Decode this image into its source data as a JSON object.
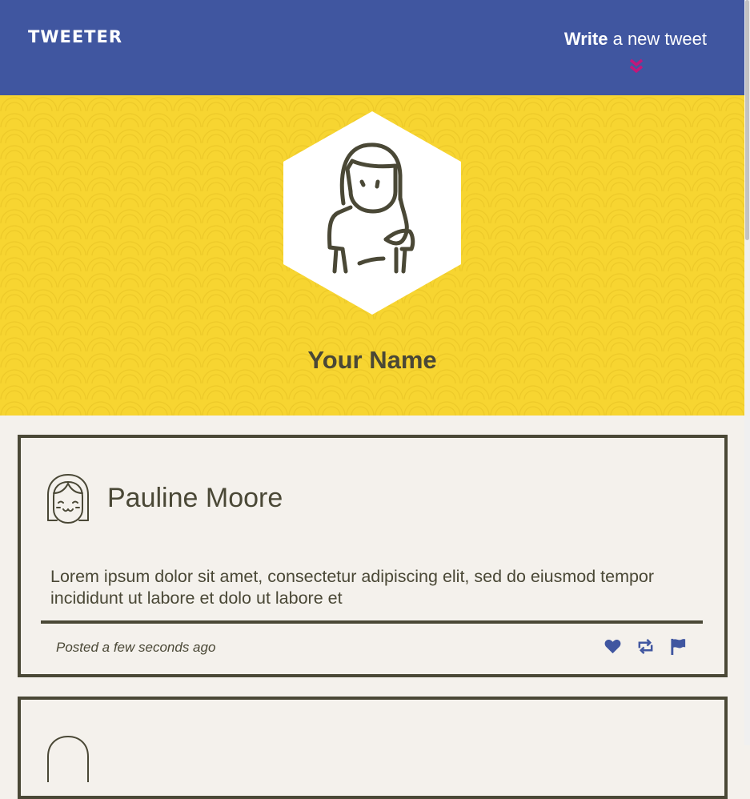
{
  "nav": {
    "brand": "TWEETER",
    "compose_bold": "Write",
    "compose_rest": " a new tweet",
    "compose_icon": "double-chevron-down-icon",
    "accent_color": "#c2177a",
    "background_color": "#4056a0"
  },
  "profile": {
    "name": "Your Name",
    "avatar_icon": "woman-avatar-icon",
    "background_color": "#f7d531"
  },
  "tweets": [
    {
      "author": "Pauline Moore",
      "avatar_icon": "girl-avatar-icon",
      "text": "Lorem ipsum dolor sit amet, consectetur adipiscing elit, sed do eiusmod tempor incididunt ut labore et dolo ut labore et",
      "posted": "Posted a few seconds ago",
      "actions": [
        "heart-icon",
        "retweet-icon",
        "flag-icon"
      ]
    }
  ],
  "colors": {
    "text": "#4a4836",
    "page_background": "#f4f1ec",
    "icon_accent": "#4056a0"
  }
}
